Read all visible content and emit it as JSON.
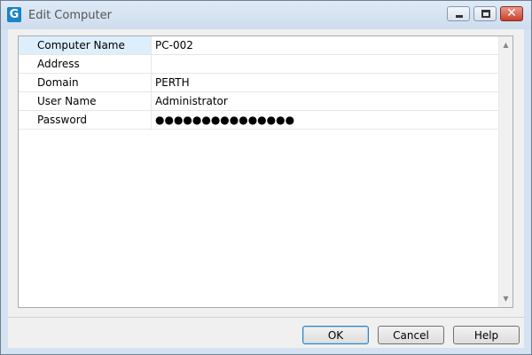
{
  "window": {
    "title": "Edit Computer",
    "app_icon_letter": "G"
  },
  "title_buttons": {
    "close_glyph": "✕"
  },
  "properties": [
    {
      "name": "Computer Name",
      "value": "PC-002"
    },
    {
      "name": "Address",
      "value": ""
    },
    {
      "name": "Domain",
      "value": "PERTH"
    },
    {
      "name": "User Name",
      "value": "Administrator"
    },
    {
      "name": "Password",
      "value": "●●●●●●●●●●●●●●●"
    }
  ],
  "scrollbar": {
    "up_glyph": "▲",
    "down_glyph": "▼"
  },
  "buttons": {
    "ok": "OK",
    "cancel": "Cancel",
    "help": "Help"
  }
}
